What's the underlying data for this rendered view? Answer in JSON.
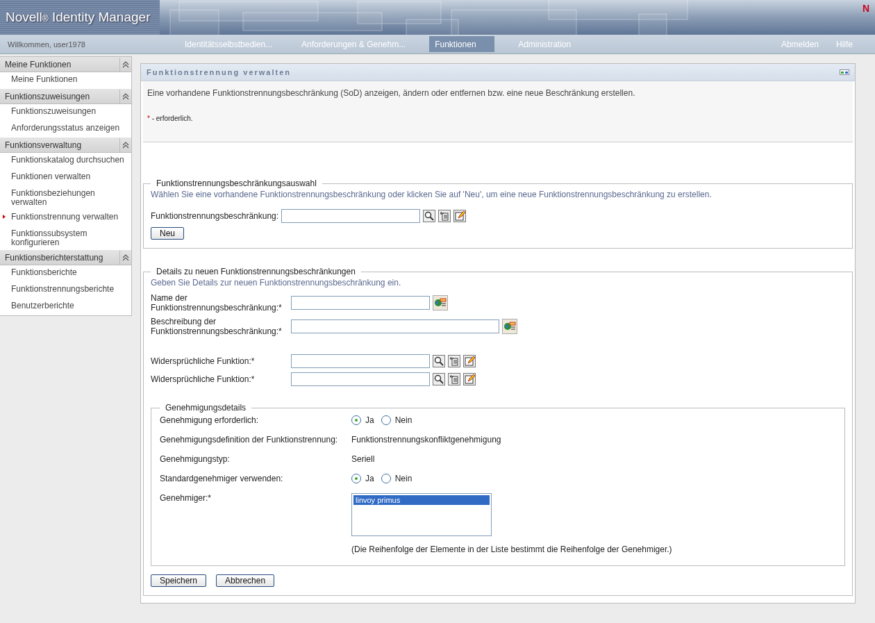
{
  "header": {
    "brand": "Novell",
    "registered": "®",
    "product": "Identity Manager",
    "logo_letter": "N"
  },
  "nav": {
    "welcome": "Willkommen, user1978",
    "tabs": [
      {
        "label": "Identitätsselbstbedien...",
        "selected": false
      },
      {
        "label": "Anforderungen & Genehm...",
        "selected": false
      },
      {
        "label": "Funktionen",
        "selected": true
      },
      {
        "label": "Administration",
        "selected": false
      }
    ],
    "links": [
      "Abmelden",
      "Hilfe"
    ]
  },
  "sidebar": [
    {
      "title": "Meine Funktionen",
      "expanded": true,
      "items": [
        {
          "label": "Meine Funktionen",
          "selected": false
        }
      ]
    },
    {
      "title": "Funktionszuweisungen",
      "expanded": true,
      "items": [
        {
          "label": "Funktionszuweisungen",
          "selected": false
        },
        {
          "label": "Anforderungsstatus anzeigen",
          "selected": false
        }
      ]
    },
    {
      "title": "Funktionsverwaltung",
      "expanded": true,
      "items": [
        {
          "label": "Funktionskatalog durchsuchen",
          "selected": false
        },
        {
          "label": "Funktionen verwalten",
          "selected": false
        },
        {
          "label": "Funktionsbeziehungen verwalten",
          "selected": false
        },
        {
          "label": "Funktionstrennung verwalten",
          "selected": true
        },
        {
          "label": "Funktionssubsystem konfigurieren",
          "selected": false
        }
      ]
    },
    {
      "title": "Funktionsberichterstattung",
      "expanded": true,
      "items": [
        {
          "label": "Funktionsberichte",
          "selected": false
        },
        {
          "label": "Funktionstrennungsberichte",
          "selected": false
        },
        {
          "label": "Benutzerberichte",
          "selected": false
        }
      ]
    }
  ],
  "panel": {
    "title": "Funktionstrennung verwalten",
    "intro": "Eine vorhandene Funktionstrennungsbeschränkung (SoD) anzeigen, ändern oder entfernen bzw. eine neue Beschränkung erstellen.",
    "required_mark": "*",
    "required_note": " - erforderlich.",
    "selection": {
      "legend": "Funktionstrennungsbeschränkungsauswahl",
      "hint": "Wählen Sie eine vorhandene Funktionstrennungsbeschränkung oder klicken Sie auf 'Neu', um eine neue Funktionstrennungsbeschränkung zu erstellen.",
      "field_label": "Funktionstrennungsbeschränkung:",
      "button": "Neu"
    },
    "details": {
      "legend": "Details zu neuen Funktionstrennungsbeschränkungen",
      "hint": "Geben Sie Details zur neuen Funktionstrennungsbeschränkung ein.",
      "fields": [
        {
          "label": "Name der Funktionstrennungsbeschränkung:*",
          "kind": "localized",
          "wide": false
        },
        {
          "label": "Beschreibung der Funktionstrennungsbeschränkung:*",
          "kind": "localized",
          "wide": true
        },
        {
          "label": "Widersprüchliche Funktion:*",
          "kind": "lookup",
          "wide": false
        },
        {
          "label": "Widersprüchliche Funktion:*",
          "kind": "lookup",
          "wide": false
        }
      ]
    },
    "approval": {
      "legend": "Genehmigungsdetails",
      "rows": [
        {
          "label": "Genehmigung erforderlich:",
          "kind": "radio",
          "options": [
            {
              "label": "Ja",
              "selected": true
            },
            {
              "label": "Nein",
              "selected": false
            }
          ]
        },
        {
          "label": "Genehmigungsdefinition der Funktionstrennung:",
          "kind": "text",
          "value": "Funktionstrennungskonfliktgenehmigung"
        },
        {
          "label": "Genehmigungstyp:",
          "kind": "text",
          "value": "Seriell"
        },
        {
          "label": "Standardgenehmiger verwenden:",
          "kind": "radio",
          "options": [
            {
              "label": "Ja",
              "selected": true
            },
            {
              "label": "Nein",
              "selected": false
            }
          ]
        },
        {
          "label": "Genehmiger:*",
          "kind": "list",
          "items": [
            {
              "label": "linvoy primus",
              "selected": true
            }
          ],
          "note": "(Die Reihenfolge der Elemente in der Liste bestimmt die Reihenfolge der Genehmiger.)"
        }
      ]
    },
    "buttons": [
      "Speichern",
      "Abbrechen"
    ]
  }
}
